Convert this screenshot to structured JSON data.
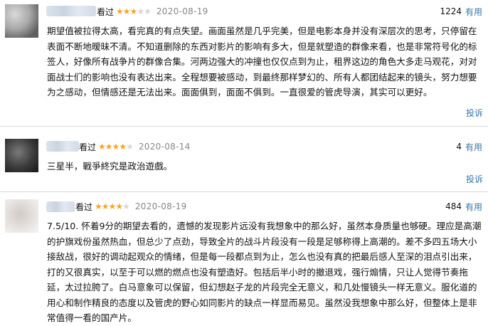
{
  "reviews": [
    {
      "status": "看过",
      "rating": 3,
      "date": "2020-08-19",
      "useful_count": "1224",
      "useful_label": "有用",
      "content": "期望值被拉得太高，看完真的有点失望。画面虽然是几乎完美，但是电影本身并没有深层次的思考，只停留在表面不断地暧昧不清。不知道删除的东西对影片的影响有多大，但是就塑造的群像来看，也是非常符号化的标签人，好像所有战争片的群像合集。河两边强大的冲撞也仅仅点到为止，租界这边的角色大多走马观花，对对面战士们的影响也没有表达出来。全程想要被感动，到最终那样梦幻的、所有人都团结起来的镜头，努力想要为之感动，但情感还是无法出来。面面俱到，面面不俱到。一直很爱的管虎导演，其实可以更好。",
      "report_label": "投诉",
      "avatar_colors": [
        "#c9c9c9",
        "#9a9a9a",
        "#6d6d6d"
      ]
    },
    {
      "status": "看过",
      "rating": 4,
      "date": "2020-08-14",
      "useful_count": "4",
      "useful_label": "有用",
      "content": "三星半，戰爭終究是政治遊戲。",
      "report_label": "投诉",
      "avatar_colors": [
        "#8c8c8c",
        "#4e4e4e",
        "#2a2a2a"
      ]
    },
    {
      "status": "看过",
      "rating": 4,
      "date": "2020-08-19",
      "useful_count": "484",
      "useful_label": "有用",
      "content": "7.5/10. 怀着9分的期望去看的，遗憾的发现影片远没有我想象中的那么好，虽然本身质量也够硬。理应是高潮的护旗戏份虽然热血，但总少了点劲，导致全片的战斗片段没有一段是足够称得上高潮的。差不多四五场大小接敌战，很好的调动起观众的情绪，但是每一段都点到为止，怎么也没有真的把最后感人至深的泪点引出来，打的又很真实，以至于可以燃的燃点也没有塑造好。包括后半小时的撤退戏，强行煽情，只让人觉得节奏拖延，太过拉胯了。白马意象可以保留，但幻想赵子龙的片段完全无意义，和几处慢镜头一样无意义。服化道的用心和制作精良的态度以及管虎的野心如同影片的缺点一样显而易见。虽然没我想象中那么好，但整体上是非常值得一看的国产片。",
      "avatar_colors": [
        "#e4e0de",
        "#cfc8c4",
        "#b9b1ad"
      ]
    }
  ],
  "colors": {
    "star_on": "#f5a623",
    "star_off": "#d6d6d6",
    "link": "#3377aa",
    "date": "#888888",
    "divider": "#d8d8d8"
  },
  "icons": {
    "star": "star-icon"
  }
}
